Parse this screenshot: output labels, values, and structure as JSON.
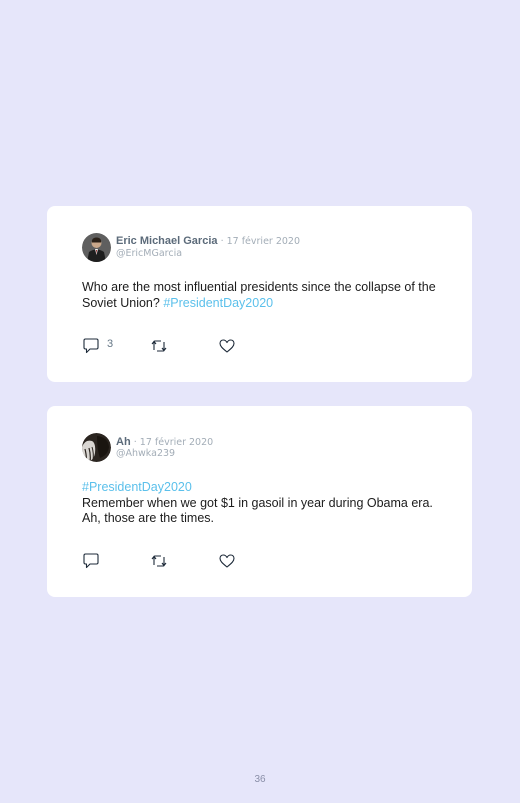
{
  "tweets": [
    {
      "author": "Eric Michael Garcia",
      "date": "· 17 février 2020",
      "handle": "@EricMGarcia",
      "text": "Who are the most influential presidents since the collapse of the Soviet Union? ",
      "hashtag": "#PresidentDay2020",
      "reply_count": "3",
      "avatar_color": "#3a3a3a"
    },
    {
      "author": "Ah",
      "date": "· 17 février 2020",
      "handle": "@Ahwka239",
      "hashtag": "#PresidentDay2020",
      "text": "Remember when we got $1 in gasoil in year during Obama era. Ah, those are the times.",
      "reply_count": "",
      "avatar_color": "#2b2520"
    }
  ],
  "icons": {
    "reply": "speech-bubble-icon",
    "retweet": "retweet-arrows-icon",
    "like": "heart-outline-icon"
  },
  "colors": {
    "background": "#e6e6fa",
    "card": "#ffffff",
    "hashtag": "#5bc0eb",
    "muted": "#a3adb7"
  },
  "page_number": "36"
}
